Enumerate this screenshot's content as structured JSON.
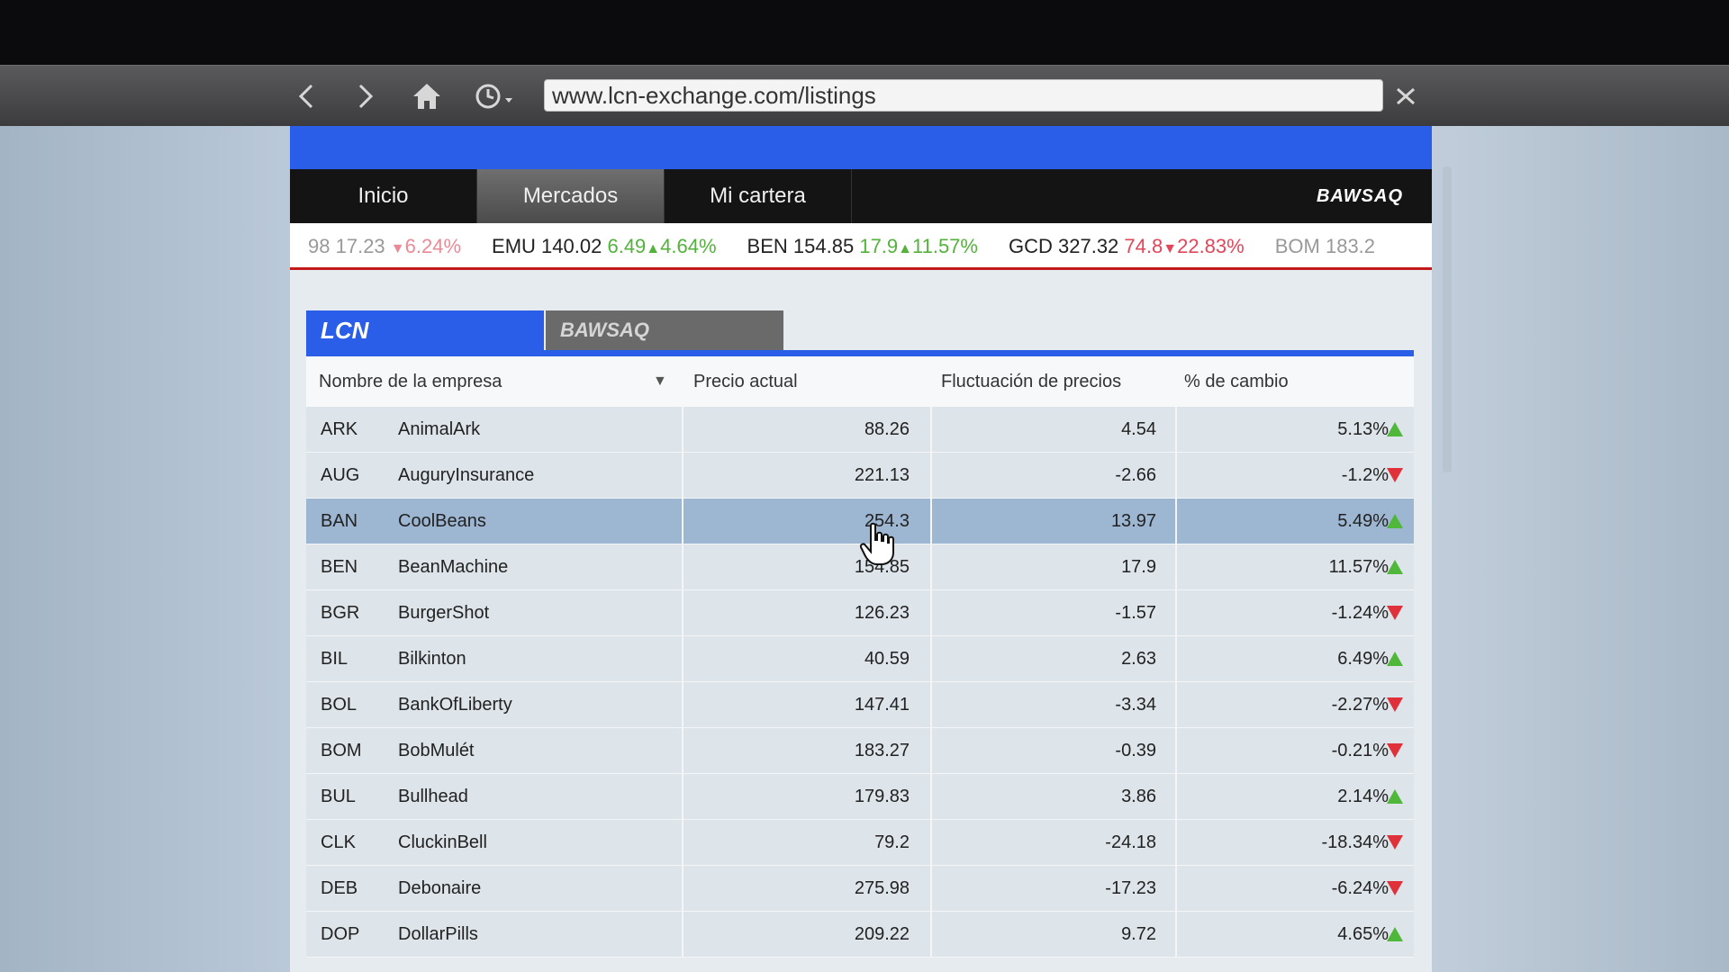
{
  "browser": {
    "url": "www.lcn-exchange.com/listings",
    "icons": [
      "back-arrow-icon",
      "forward-arrow-icon",
      "home-icon",
      "history-clock-icon",
      "close-icon"
    ]
  },
  "nav": {
    "items": [
      {
        "label": "Inicio"
      },
      {
        "label": "Mercados"
      },
      {
        "label": "Mi cartera"
      }
    ],
    "active": "Mercados",
    "logo": "BAWSAQ"
  },
  "ticker": [
    {
      "sym": "98",
      "price": "17.23",
      "change": "",
      "pct": "6.24%",
      "dir": "down",
      "faded": true
    },
    {
      "sym": "EMU",
      "price": "140.02",
      "change": "6.49",
      "pct": "4.64%",
      "dir": "up"
    },
    {
      "sym": "BEN",
      "price": "154.85",
      "change": "17.9",
      "pct": "11.57%",
      "dir": "up"
    },
    {
      "sym": "GCD",
      "price": "327.32",
      "change": "74.8",
      "pct": "22.83%",
      "dir": "down"
    },
    {
      "sym": "BOM",
      "price": "183.2",
      "change": "",
      "pct": "",
      "dir": "",
      "faded": true
    }
  ],
  "exchange_tabs": {
    "lcn": "LCN",
    "bawsaq": "BAWSAQ"
  },
  "table": {
    "headers": {
      "company": "Nombre de la empresa",
      "price": "Precio actual",
      "fluctuation": "Fluctuación de precios",
      "change": "% de cambio"
    },
    "rows": [
      {
        "sym": "ARK",
        "name": "AnimalArk",
        "price": "88.26",
        "fluc": "4.54",
        "pct": "5.13%",
        "dir": "up"
      },
      {
        "sym": "AUG",
        "name": "AuguryInsurance",
        "price": "221.13",
        "fluc": "-2.66",
        "pct": "-1.2%",
        "dir": "down"
      },
      {
        "sym": "BAN",
        "name": "CoolBeans",
        "price": "254.3",
        "fluc": "13.97",
        "pct": "5.49%",
        "dir": "up",
        "highlight": true
      },
      {
        "sym": "BEN",
        "name": "BeanMachine",
        "price": "154.85",
        "fluc": "17.9",
        "pct": "11.57%",
        "dir": "up"
      },
      {
        "sym": "BGR",
        "name": "BurgerShot",
        "price": "126.23",
        "fluc": "-1.57",
        "pct": "-1.24%",
        "dir": "down"
      },
      {
        "sym": "BIL",
        "name": "Bilkinton",
        "price": "40.59",
        "fluc": "2.63",
        "pct": "6.49%",
        "dir": "up"
      },
      {
        "sym": "BOL",
        "name": "BankOfLiberty",
        "price": "147.41",
        "fluc": "-3.34",
        "pct": "-2.27%",
        "dir": "down"
      },
      {
        "sym": "BOM",
        "name": "BobMulét",
        "price": "183.27",
        "fluc": "-0.39",
        "pct": "-0.21%",
        "dir": "down"
      },
      {
        "sym": "BUL",
        "name": "Bullhead",
        "price": "179.83",
        "fluc": "3.86",
        "pct": "2.14%",
        "dir": "up"
      },
      {
        "sym": "CLK",
        "name": "CluckinBell",
        "price": "79.2",
        "fluc": "-24.18",
        "pct": "-18.34%",
        "dir": "down"
      },
      {
        "sym": "DEB",
        "name": "Debonaire",
        "price": "275.98",
        "fluc": "-17.23",
        "pct": "-6.24%",
        "dir": "down"
      },
      {
        "sym": "DOP",
        "name": "DollarPills",
        "price": "209.22",
        "fluc": "9.72",
        "pct": "4.65%",
        "dir": "up"
      }
    ]
  },
  "colors": {
    "accent_blue": "#2a5ee8",
    "up_green": "#4fb83a",
    "down_red": "#e0303a",
    "ticker_border": "#c21a1a"
  }
}
